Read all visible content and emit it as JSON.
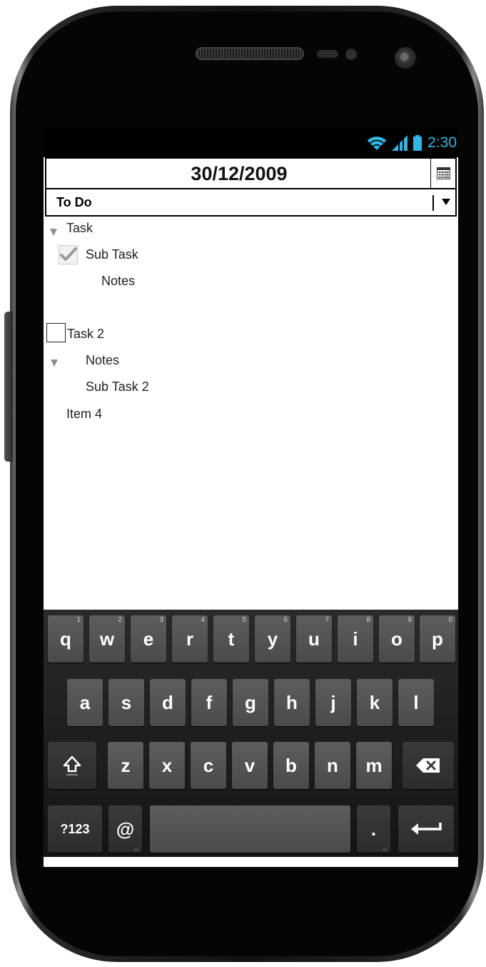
{
  "status_bar": {
    "time": "2:30",
    "wifi_icon": "wifi-icon",
    "signal_icon": "signal-icon",
    "battery_icon": "battery-icon",
    "accent_color": "#33b5e5"
  },
  "date_picker": {
    "value": "30/12/2009",
    "button_icon": "calendar-icon"
  },
  "list_select": {
    "value": "To Do",
    "arrow_icon": "dropdown-arrow-icon"
  },
  "tree": {
    "task_1": "Task",
    "sub_task_1": "Sub Task",
    "notes_1": "Notes",
    "task_2": "Task 2",
    "notes_2": "Notes",
    "sub_task_2": "Sub Task 2",
    "item_4": "Item 4"
  },
  "keyboard": {
    "row1": [
      {
        "label": "q",
        "hint": "1"
      },
      {
        "label": "w",
        "hint": "2"
      },
      {
        "label": "e",
        "hint": "3"
      },
      {
        "label": "r",
        "hint": "4"
      },
      {
        "label": "t",
        "hint": "5"
      },
      {
        "label": "y",
        "hint": "6"
      },
      {
        "label": "u",
        "hint": "7"
      },
      {
        "label": "i",
        "hint": "8"
      },
      {
        "label": "o",
        "hint": "9"
      },
      {
        "label": "p",
        "hint": "0"
      }
    ],
    "row2": [
      "a",
      "s",
      "d",
      "f",
      "g",
      "h",
      "j",
      "k",
      "l"
    ],
    "row3": [
      "z",
      "x",
      "c",
      "v",
      "b",
      "n",
      "m"
    ],
    "symbols_label": "?123",
    "at_label": "@",
    "period_label": ".",
    "shift_icon": "shift-icon",
    "backspace_icon": "backspace-icon",
    "enter_icon": "enter-icon"
  }
}
